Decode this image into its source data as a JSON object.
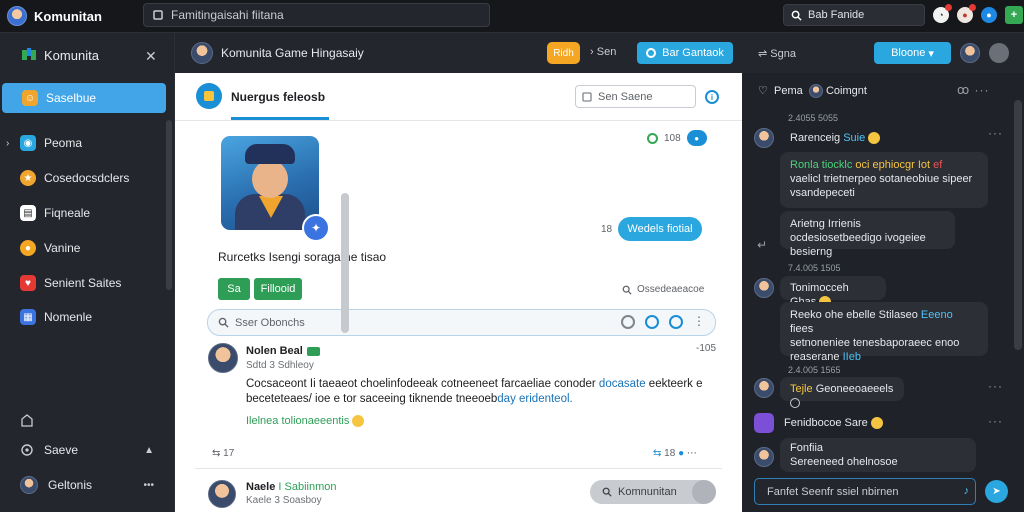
{
  "app": {
    "title": "Komunitan",
    "top_search": "Famitingaisahi fiitana"
  },
  "top_right": {
    "search_label": "Bab Fanide"
  },
  "sidebar": {
    "header": "Komunita",
    "items": [
      {
        "label": "Saselbue",
        "color": "#f0a62e"
      },
      {
        "label": "Peoma",
        "color": "#2aa7df"
      },
      {
        "label": "Cosedocsdclers",
        "color": "#f0a62e"
      },
      {
        "label": "Fiqneale",
        "color": "#ffffff"
      },
      {
        "label": "Vanine",
        "color": "#f5a623"
      },
      {
        "label": "Senient Saites",
        "color": "#e53935"
      },
      {
        "label": "Nomenle",
        "color": "#3b73e0"
      }
    ],
    "bottom": [
      {
        "label": "Saeve"
      },
      {
        "label": "Geltonis"
      }
    ]
  },
  "channel": {
    "title": "Komunita Game Hingasaiy",
    "pill": "Ridh",
    "mid_label": "Sen",
    "button": "Bar Gantaok"
  },
  "main": {
    "tab_label": "Nuergus feleosb",
    "search_placeholder": "Sen Saene",
    "status_count": "108",
    "follow_count": "18",
    "follow_button": "Wedels fiotial",
    "game_title": "Rurcetks Isengi soragathe tisao",
    "btn1": "Sa",
    "btn2": "Fillooid",
    "search_link": "Ossedeaeacoe",
    "composer_placeholder": "Sser Obonchs",
    "posts": [
      {
        "name": "Nolen Beal",
        "handle": "Sdtd 3 Sdhleoy",
        "time": "-105",
        "body": "Cocsaceont Ii taeaeot choelinfodeeak cotneeneet farcaeliae conoder ",
        "body_link1": "docasate",
        "body_mid": " eekteerk e beceteteaes/ ioe e tor saceeing tiknende tneeoeb",
        "body_link2": "day eridenteol.",
        "hashtag": "Ilelnea tolionaeeentis",
        "reply_count": "17",
        "right_actions": "18"
      },
      {
        "name": "Naele",
        "name_green": "I Sabiinmon",
        "handle": "Kaele 3 Soasboy",
        "community_pill": "Komnunitan"
      }
    ]
  },
  "rpanel": {
    "header": "Sgna",
    "button": "Bloone",
    "top_user": "Pema",
    "top_user_name": "Coimgnt",
    "messages": [
      {
        "time": "2.4055 5055"
      },
      {
        "name": "Rarenceig",
        "name_blue": "Suie"
      },
      {
        "l1a": "Ronla tiocklc",
        "l1b": "oci",
        "l1c": "ephiocgr",
        "l1d": "Iot",
        "l1e": "ef",
        "l2": "vaelicl trietnerpeo sotaneobiue sipeer vsandepeceti"
      },
      {
        "text": "Arietng Irrienis ocdesiosetbeedigo ivogeiee besierng"
      },
      {
        "time": "7.4.005 1505"
      },
      {
        "name": "Tonimocceh Ghas"
      },
      {
        "l1": "Reeko ohe ebelle Stilaseo",
        "l1_blue": "Eeeno",
        "l1_end": "fiees",
        "l2": "setnoneniee tenesbaporaeec enoo",
        "l3a": "reaserane",
        "l3b": "IIeb"
      },
      {
        "time": "2.4.005 1565"
      },
      {
        "a": "Tejle",
        "b": "Geoneeoaeeels"
      },
      {
        "name": "Fenidbocoe Sare"
      },
      {
        "n1": "Fonfiia",
        "n2": "Sereeneed ohelnosoe"
      }
    ],
    "input_placeholder": "Fanfet Seenfr ssiel nbirnen"
  }
}
